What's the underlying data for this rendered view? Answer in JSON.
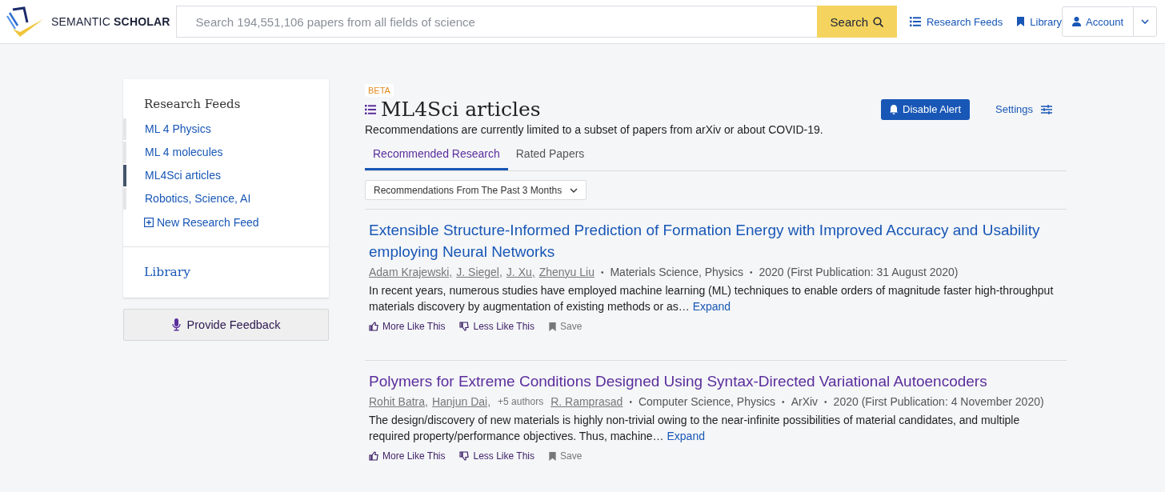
{
  "header": {
    "logo_text": "SEMANTIC **SCHOLAR**",
    "search": {
      "placeholder": "Search 194,551,106 papers from all fields of science",
      "button": "Search"
    },
    "nav": [
      {
        "label": "Research Feeds"
      },
      {
        "label": "Library"
      }
    ],
    "account": "Account"
  },
  "sidebar": {
    "title": "Research Feeds",
    "feeds": [
      {
        "label": "ML 4 Physics",
        "selected": false
      },
      {
        "label": "ML 4 molecules",
        "selected": false
      },
      {
        "label": "ML4Sci articles",
        "selected": true
      },
      {
        "label": "Robotics, Science, AI",
        "selected": false
      }
    ],
    "new_feed": "New Research Feed",
    "library": "Library",
    "feedback": "Provide Feedback"
  },
  "main": {
    "badge": "BETA",
    "title": "ML4Sci articles",
    "alert_button": "Disable Alert",
    "settings": "Settings",
    "notice": "Recommendations are currently limited to a subset of papers from arXiv or about COVID-19.",
    "tabs": [
      {
        "label": "Recommended Research",
        "selected": true
      },
      {
        "label": "Rated Papers",
        "selected": false
      }
    ],
    "filter": "Recommendations From The Past 3 Months",
    "papers": [
      {
        "title": "Extensible Structure-Informed Prediction of Formation Energy with Improved Accuracy and Usability employing Neural Networks",
        "visited": false,
        "authors": [
          {
            "kind": "author",
            "name": "Adam Krajewski,"
          },
          {
            "kind": "author",
            "name": "J. Siegel,"
          },
          {
            "kind": "author",
            "name": "J. Xu,"
          },
          {
            "kind": "author",
            "name": "Zhenyu Liu"
          }
        ],
        "separator": "•",
        "meta": [
          "Materials Science, Physics",
          "2020 (First Publication: 31 August 2020)"
        ],
        "abstract": "In recent years, numerous studies have employed machine learning (ML) techniques to enable orders of magnitude faster high-throughput materials discovery by augmentation of existing methods or as…",
        "expand": "Expand",
        "actions": [
          "More Like This",
          "Less Like This",
          "Save"
        ]
      },
      {
        "title": "Polymers for Extreme Conditions Designed Using Syntax-Directed Variational Autoencoders",
        "visited": true,
        "authors": [
          {
            "kind": "author",
            "name": "Rohit Batra,"
          },
          {
            "kind": "author",
            "name": "Hanjun Dai,"
          },
          {
            "kind": "more",
            "name": "+5 authors"
          },
          {
            "kind": "author",
            "name": "R. Ramprasad"
          }
        ],
        "separator": "•",
        "meta": [
          "Computer Science, Physics",
          "ArXiv",
          "2020 (First Publication: 4 November 2020)"
        ],
        "abstract": "The design/discovery of new materials is highly non-trivial owing to the near-infinite possibilities of material candidates, and multiple required property/performance objectives. Thus, machine…",
        "expand": "Expand",
        "actions": [
          "More Like This",
          "Less Like This",
          "Save"
        ]
      }
    ]
  }
}
